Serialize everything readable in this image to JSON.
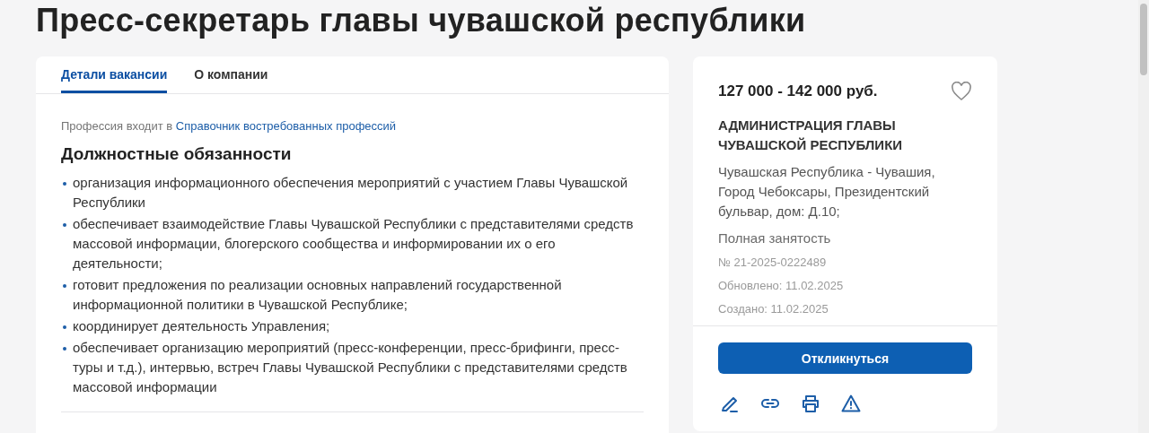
{
  "title": "Пресс-секретарь главы чувашской республики",
  "tabs": [
    {
      "label": "Детали вакансии",
      "selected": true
    },
    {
      "label": "О компании",
      "selected": false
    }
  ],
  "profession_note": {
    "text": "Профессия входит в",
    "link": "Справочник востребованных профессий"
  },
  "duties": {
    "heading": "Должностные обязанности",
    "items": [
      "организация информационного обеспечения мероприятий с участием Главы Чувашской Республики",
      "обеспечивает взаимодействие Главы Чувашской Республики с представителями средств массовой информации, блогерского сообщества и информировании их о его деятельности;",
      "готовит предложения по реализации основных направлений государственной информационной политики в Чувашской Республике;",
      "координирует деятельность Управления;",
      "обеспечивает организацию мероприятий (пресс-конференции, пресс-брифинги, пресс-туры и т.д.), интервью, встреч Главы Чувашской Республики с представителями средств массовой информации"
    ]
  },
  "summary": {
    "salary": "127 000 - 142 000 руб.",
    "favorite": false,
    "employer": "АДМИНИСТРАЦИЯ ГЛАВЫ ЧУВАШСКОЙ РЕСПУБЛИКИ",
    "address": "Чувашская Республика - Чувашия, Город Чебоксары, Президентский бульвар, дом: Д.10;",
    "employment": "Полная занятость",
    "number": "№ 21-2025-0222489",
    "updated": "Обновлено: 11.02.2025",
    "created": "Создано: 11.02.2025",
    "apply_button": "Откликнуться"
  }
}
